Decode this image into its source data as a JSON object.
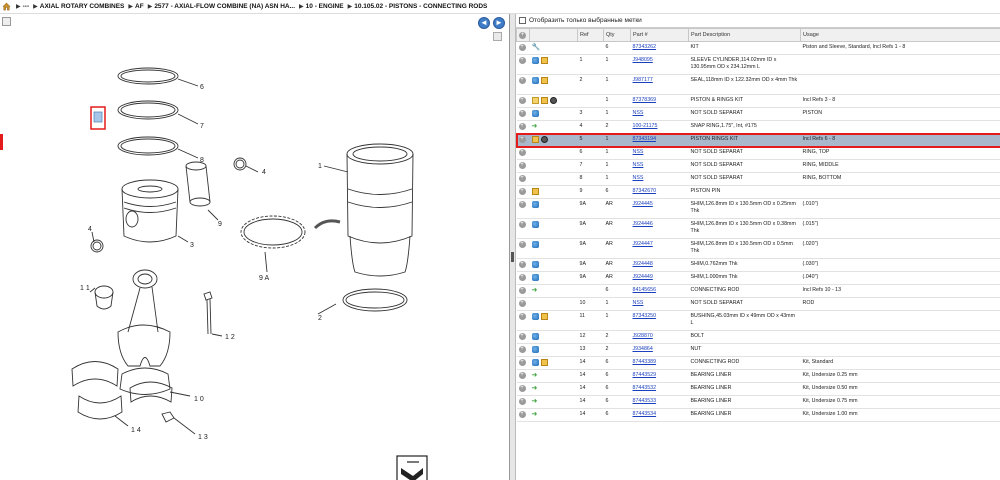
{
  "breadcrumb": [
    {
      "label": "---"
    },
    {
      "label": "AXIAL ROTARY COMBINES"
    },
    {
      "label": "AF"
    },
    {
      "label": "2577 - AXIAL-FLOW COMBINE (NA) ASN HA..."
    },
    {
      "label": "10 - ENGINE"
    },
    {
      "label": "10.105.02 - PISTONS - CONNECTING RODS"
    }
  ],
  "nav": {
    "back": "◄",
    "forward": "►"
  },
  "filter": {
    "label": "Отобразить только выбранные метки"
  },
  "table": {
    "headers": [
      "",
      "",
      "Ref",
      "Qty",
      "Part #",
      "Part Description",
      "Usage"
    ],
    "rows": [
      {
        "icons": [
          "wrench-icon"
        ],
        "ref": "",
        "qty": "6",
        "part": "87343262",
        "desc": "KIT",
        "usage": "Piston and Sleeve, Standard, Incl Refs 1 - 8"
      },
      {
        "icons": [
          "blue-icon",
          "box-icon"
        ],
        "ref": "1",
        "qty": "1",
        "part": "J948095",
        "desc": "SLEEVE CYLINDER,114.02mm ID x 130.95mm OD x 234.12mm L",
        "usage": "",
        "tall": true
      },
      {
        "icons": [
          "blue-icon",
          "box-icon"
        ],
        "ref": "2",
        "qty": "1",
        "part": "J987177",
        "desc": "SEAL,118mm ID x 122.32mm OD x 4mm Thk",
        "usage": "",
        "tall": true
      },
      {
        "icons": [
          "folder-icon",
          "box-icon",
          "disk-icon"
        ],
        "ref": "",
        "qty": "1",
        "part": "87378369",
        "desc": "PISTON & RINGS KIT",
        "usage": "Incl Refs 3 - 8"
      },
      {
        "icons": [
          "blue-icon"
        ],
        "ref": "3",
        "qty": "1",
        "part": "NSS",
        "desc": "NOT SOLD SEPARAT",
        "usage": "PISTON"
      },
      {
        "icons": [
          "green-icon"
        ],
        "ref": "4",
        "qty": "2",
        "part": "100-21175",
        "desc": "SNAP RING,1.75\", Int, #175",
        "usage": ""
      },
      {
        "icons": [
          "box-icon",
          "disk-icon"
        ],
        "ref": "5",
        "qty": "1",
        "part": "87343194",
        "desc": "PISTON RINGS KIT",
        "usage": "Incl Refs 6 - 8",
        "selected": true
      },
      {
        "icons": [],
        "ref": "6",
        "qty": "1",
        "part": "NSS",
        "desc": "NOT SOLD SEPARAT",
        "usage": "RING, TOP"
      },
      {
        "icons": [],
        "ref": "7",
        "qty": "1",
        "part": "NSS",
        "desc": "NOT SOLD SEPARAT",
        "usage": "RING, MIDDLE"
      },
      {
        "icons": [],
        "ref": "8",
        "qty": "1",
        "part": "NSS",
        "desc": "NOT SOLD SEPARAT",
        "usage": "RING, BOTTOM"
      },
      {
        "icons": [
          "box-icon"
        ],
        "ref": "9",
        "qty": "6",
        "part": "87342670",
        "desc": "PISTON PIN",
        "usage": ""
      },
      {
        "icons": [
          "blue-icon"
        ],
        "ref": "9A",
        "qty": "AR",
        "part": "J924445",
        "desc": "SHIM,126.8mm ID x 130.5mm OD x 0.25mm Thk",
        "usage": "(.010\")",
        "tall": true
      },
      {
        "icons": [
          "blue-icon"
        ],
        "ref": "9A",
        "qty": "AR",
        "part": "J924446",
        "desc": "SHIM,126.8mm ID x 130.5mm OD x 0.38mm Thk",
        "usage": "(.015\")",
        "tall": true
      },
      {
        "icons": [
          "blue-icon"
        ],
        "ref": "9A",
        "qty": "AR",
        "part": "J924447",
        "desc": "SHIM,126.8mm ID x 130.5mm OD x 0.5mm Thk",
        "usage": "(.020\")",
        "tall": true
      },
      {
        "icons": [
          "blue-icon"
        ],
        "ref": "9A",
        "qty": "AR",
        "part": "J924448",
        "desc": "SHIM,0.762mm Thk",
        "usage": "(.030\")"
      },
      {
        "icons": [
          "blue-icon"
        ],
        "ref": "9A",
        "qty": "AR",
        "part": "J924449",
        "desc": "SHIM,1.000mm Thk",
        "usage": "(.040\")"
      },
      {
        "icons": [
          "green-icon"
        ],
        "ref": "",
        "qty": "6",
        "part": "84145656",
        "desc": "CONNECTING ROD",
        "usage": "Incl Refs 10 - 13"
      },
      {
        "icons": [],
        "ref": "10",
        "qty": "1",
        "part": "NSS",
        "desc": "NOT SOLD SEPARAT",
        "usage": "ROD"
      },
      {
        "icons": [
          "blue-icon",
          "box-icon"
        ],
        "ref": "11",
        "qty": "1",
        "part": "87343250",
        "desc": "BUSHING,45.03mm ID x 49mm OD x 43mm L",
        "usage": "",
        "tall": true
      },
      {
        "icons": [
          "blue-icon"
        ],
        "ref": "12",
        "qty": "2",
        "part": "J928870",
        "desc": "BOLT",
        "usage": ""
      },
      {
        "icons": [
          "blue-icon"
        ],
        "ref": "13",
        "qty": "2",
        "part": "J934864",
        "desc": "NUT",
        "usage": ""
      },
      {
        "icons": [
          "blue-icon",
          "box-icon"
        ],
        "ref": "14",
        "qty": "6",
        "part": "87443389",
        "desc": "CONNECTING ROD",
        "usage": "Kit, Standard"
      },
      {
        "icons": [
          "green-icon"
        ],
        "ref": "14",
        "qty": "6",
        "part": "87443529",
        "desc": "BEARING LINER",
        "usage": "Kit, Undersize 0.25 mm"
      },
      {
        "icons": [
          "green-icon"
        ],
        "ref": "14",
        "qty": "6",
        "part": "87443532",
        "desc": "BEARING LINER",
        "usage": "Kit, Undersize 0.50 mm"
      },
      {
        "icons": [
          "green-icon"
        ],
        "ref": "14",
        "qty": "6",
        "part": "87443533",
        "desc": "BEARING LINER",
        "usage": "Kit, Undersize 0.75 mm"
      },
      {
        "icons": [
          "green-icon"
        ],
        "ref": "14",
        "qty": "6",
        "part": "87443534",
        "desc": "BEARING LINER",
        "usage": "Kit, Undersize 1.00 mm"
      }
    ]
  },
  "diagram": {
    "callouts": [
      "1",
      "2",
      "3",
      "4",
      "4",
      "6",
      "7",
      "8",
      "9",
      "9 A",
      "1 1",
      "1 2",
      "1 0",
      "1 4",
      "1 3"
    ]
  },
  "colors": {
    "selection_outline": "#e31b1b",
    "selection_fill": "#aab8cc",
    "link": "#1a3fbf",
    "nav_button": "#3f7cc7"
  }
}
